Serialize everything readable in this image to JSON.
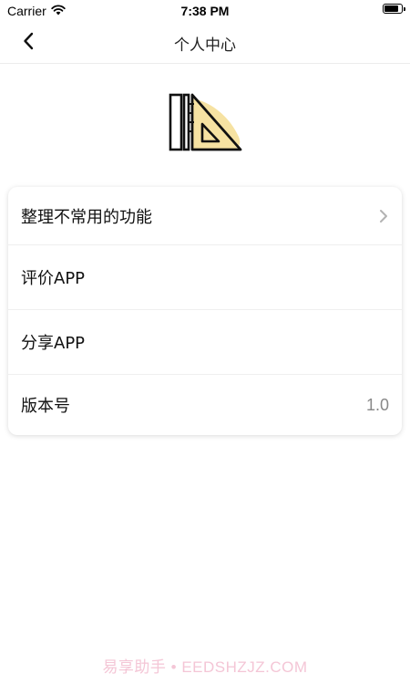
{
  "status_bar": {
    "carrier": "Carrier",
    "time": "7:38 PM",
    "battery_level": 0.9
  },
  "nav": {
    "title": "个人中心",
    "back_icon": "chevron-left-icon"
  },
  "logo": {
    "icon": "ruler-set-square-icon",
    "accent_color": "#f6e2a2"
  },
  "menu": {
    "items": [
      {
        "label": "整理不常用的功能",
        "icon": "chevron-right-icon"
      },
      {
        "label": "评价APP"
      },
      {
        "label": "分享APP"
      },
      {
        "label": "版本号",
        "value": "1.0"
      }
    ]
  },
  "watermark": {
    "text": "易享助手 • EEDSHZJZ.COM"
  },
  "colors": {
    "background": "#ffffff",
    "divider": "#efefef",
    "secondary_text": "#888888",
    "watermark": "#f4c6d6"
  }
}
